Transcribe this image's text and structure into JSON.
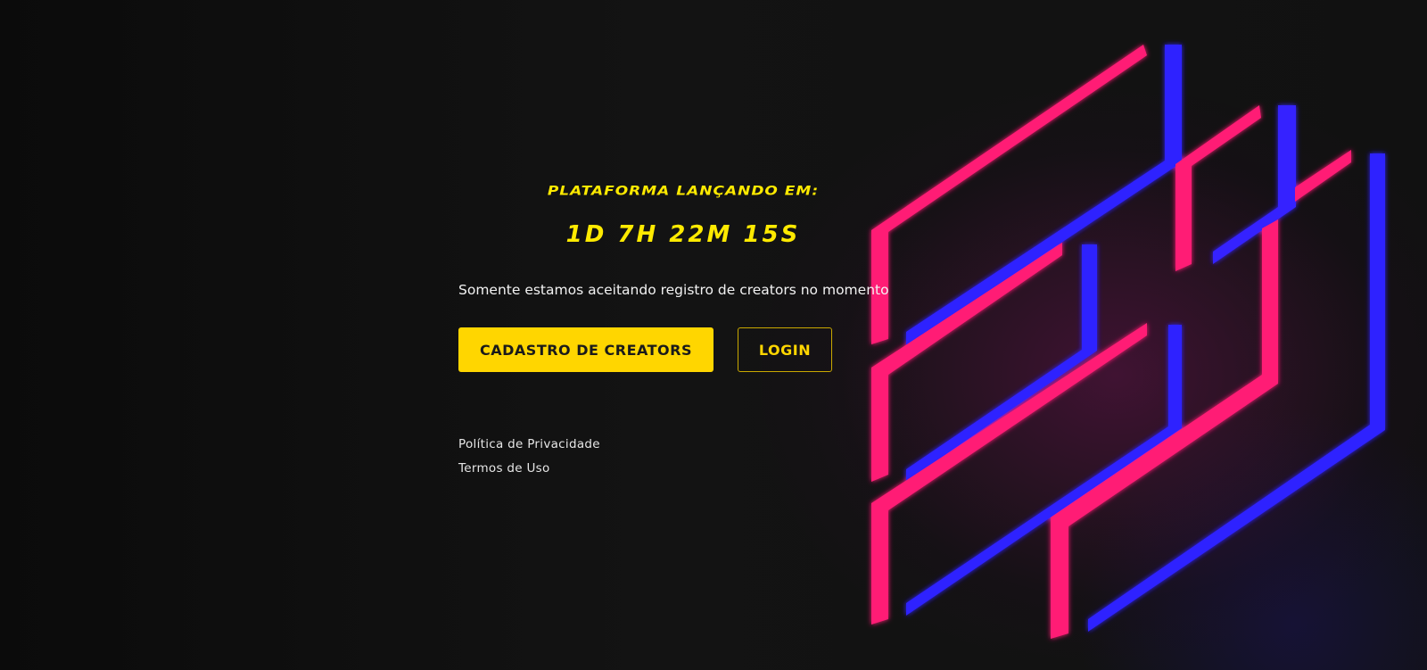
{
  "launch": {
    "label": "PLATAFORMA LANÇANDO EM:",
    "countdown": "1D 7H 22M 15S"
  },
  "notice": "Somente estamos aceitando registro de creators no momento",
  "actions": {
    "creator_signup_label": "CADASTRO DE CREATORS",
    "login_label": "LOGIN"
  },
  "footer": {
    "privacy_label": "Política de Privacidade",
    "terms_label": "Termos de Uso"
  },
  "colors": {
    "accent_yellow": "#ffd600",
    "neon_pink": "#ff1f75",
    "neon_blue": "#2e20ff",
    "background": "#0e0e0e"
  }
}
